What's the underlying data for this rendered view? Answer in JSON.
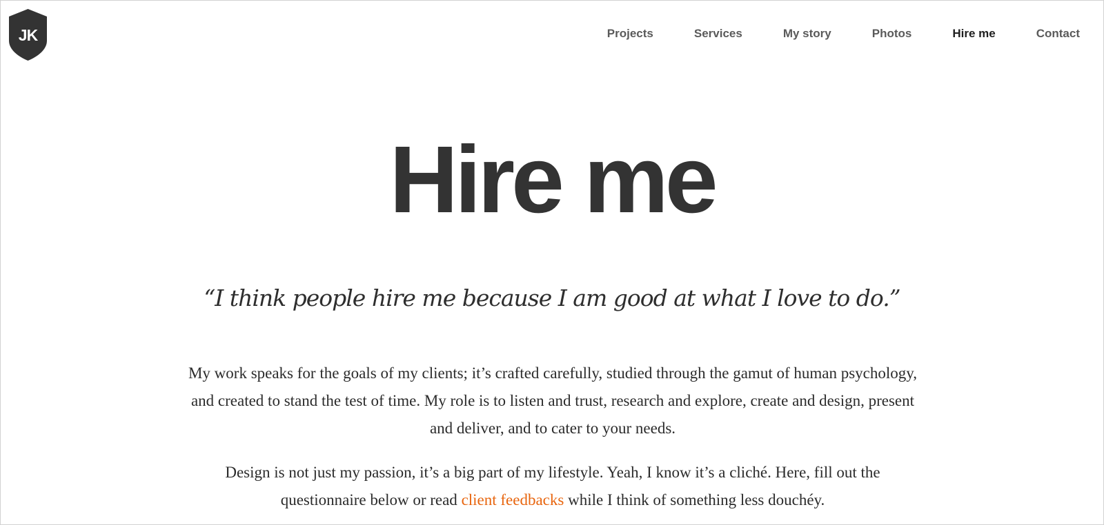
{
  "brand": {
    "logo_text": "JK",
    "shield_color": "#333333"
  },
  "nav": {
    "items": [
      {
        "label": "Projects"
      },
      {
        "label": "Services"
      },
      {
        "label": "My story"
      },
      {
        "label": "Photos"
      },
      {
        "label": "Hire me",
        "active": true
      },
      {
        "label": "Contact"
      }
    ]
  },
  "main": {
    "title": "Hire me",
    "quote": "“I think people hire me because I am good at what I love to do.”",
    "paragraph1": "My work speaks for the goals of my clients; it’s crafted carefully, studied through the gamut of human psychology, and created to stand the test of time. My role is to listen and trust, research and explore, create and design, present and deliver, and to cater to your needs.",
    "paragraph2": {
      "before": "Design is not just my passion, it’s a big part of my lifestyle. Yeah, I know it’s a cliché. Here, fill out the questionnaire below or read ",
      "link": "client feedbacks",
      "after": " while I think of something less douchéy."
    }
  },
  "colors": {
    "link": "#e8650e",
    "nav_text": "#5a5a5a",
    "nav_active": "#1f1f1f",
    "heading": "#333333"
  }
}
